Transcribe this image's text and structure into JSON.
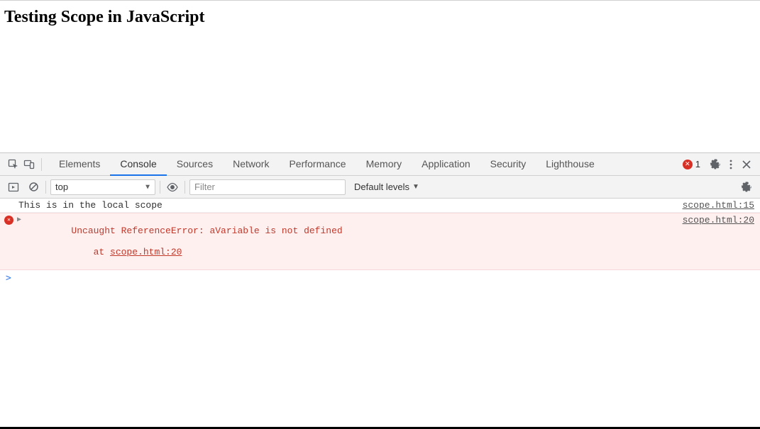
{
  "page": {
    "heading": "Testing Scope in JavaScript"
  },
  "devtools": {
    "tabs": {
      "elements": "Elements",
      "console": "Console",
      "sources": "Sources",
      "network": "Network",
      "performance": "Performance",
      "memory": "Memory",
      "application": "Application",
      "security": "Security",
      "lighthouse": "Lighthouse"
    },
    "active_tab": "console",
    "error_count": "1",
    "toolbar": {
      "context": "top",
      "filter_placeholder": "Filter",
      "filter_value": "",
      "levels_label": "Default levels"
    },
    "messages": {
      "log1": {
        "text": "This is in the local scope",
        "source": "scope.html:15"
      },
      "error1": {
        "line1": "Uncaught ReferenceError: aVariable is not defined",
        "line2_prefix": "    at ",
        "line2_link": "scope.html:20",
        "source": "scope.html:20"
      }
    }
  }
}
